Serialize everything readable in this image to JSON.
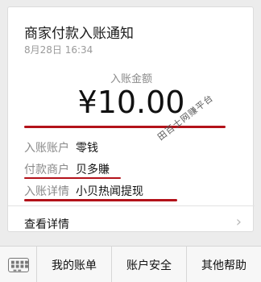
{
  "notification": {
    "title": "商家付款入账通知",
    "date": "8月28日",
    "time": "16:34",
    "amount_label": "入账金额",
    "amount": "¥10.00",
    "rows": [
      {
        "label": "入账账户",
        "value": "零钱"
      },
      {
        "label": "付款商户",
        "value": "贝多賺"
      },
      {
        "label": "入账详情",
        "value": "小贝热闻提现"
      }
    ],
    "details_link": "查看详情"
  },
  "watermark": "田百士网赚平台",
  "bottom_menu": {
    "items": [
      "我的账单",
      "账户安全",
      "其他帮助"
    ]
  },
  "colors": {
    "annotation_red": "#b3121a"
  }
}
